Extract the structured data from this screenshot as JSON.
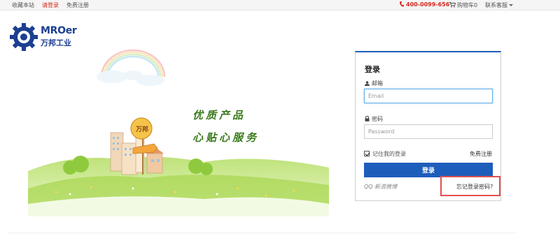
{
  "topbar": {
    "bookmark": "收藏本站",
    "login": "请登录",
    "register": "免费注册",
    "phone": "400-0099-656",
    "cart": "购物车0",
    "service": "联系客服"
  },
  "logo": {
    "en": "MROer",
    "cn": "万邦工业"
  },
  "banner": {
    "sign": "万邦",
    "slogan_line1": "优质产品",
    "slogan_line2": "心贴心服务"
  },
  "login_panel": {
    "title": "登录",
    "email_label": "邮箱",
    "email_placeholder": "Email",
    "password_label": "密码",
    "password_placeholder": "Password",
    "remember_label": "记住我的登录",
    "register_link": "免费注册",
    "submit_label": "登录",
    "social_login": "QQ  新浪微博",
    "forgot_link": "忘记登录密码?"
  },
  "colors": {
    "accent_blue": "#1d5dbb",
    "brand_red": "#d6261d",
    "highlight_red": "#e05050"
  }
}
